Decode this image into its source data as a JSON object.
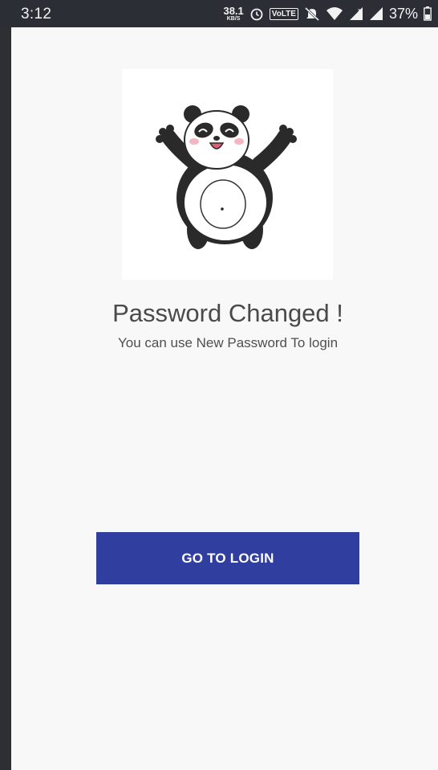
{
  "status_bar": {
    "time": "3:12",
    "net_speed_value": "38.1",
    "net_speed_unit": "KB/S",
    "volte_label": "VoLTE",
    "battery_percent": "37%",
    "icons": [
      "alarm-icon",
      "volte-icon",
      "mute-icon",
      "wifi-icon",
      "signal-icon",
      "signal-roaming-icon",
      "battery-icon"
    ]
  },
  "content": {
    "illustration": "panda-icon",
    "title": "Password Changed !",
    "subtitle": "You can use New Password To login"
  },
  "actions": {
    "login_button_label": "GO TO LOGIN"
  },
  "colors": {
    "accent": "#303f9f",
    "background": "#f8f8f8",
    "statusbar": "#2b2e35"
  }
}
